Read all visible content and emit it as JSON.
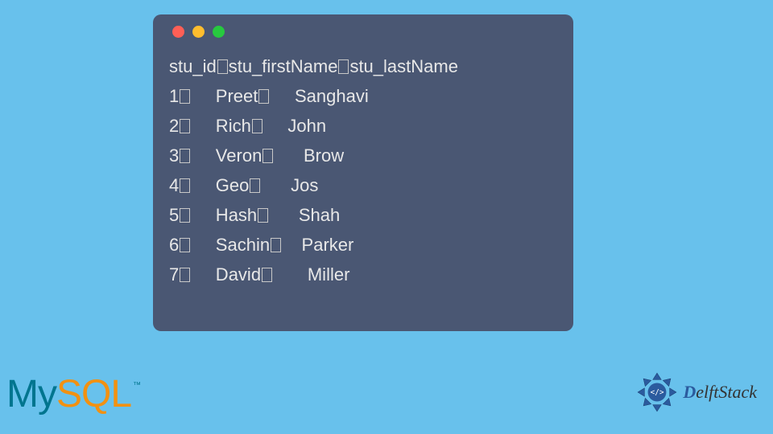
{
  "terminal": {
    "header_line": "stu_id▯stu_firstName▯stu_lastName",
    "rows": [
      {
        "id": "1",
        "first": "Preet",
        "last": "Sanghavi"
      },
      {
        "id": "2",
        "first": "Rich",
        "last": "John"
      },
      {
        "id": "3",
        "first": "Veron",
        "last": "Brow"
      },
      {
        "id": "4",
        "first": "Geo",
        "last": "Jos"
      },
      {
        "id": "5",
        "first": "Hash",
        "last": "Shah"
      },
      {
        "id": "6",
        "first": "Sachin",
        "last": "Parker"
      },
      {
        "id": "7",
        "first": "David",
        "last": "Miller"
      }
    ]
  },
  "logos": {
    "mysql_my": "My",
    "mysql_sql": "SQL",
    "mysql_tm": "™",
    "delft": "DelftStack"
  }
}
